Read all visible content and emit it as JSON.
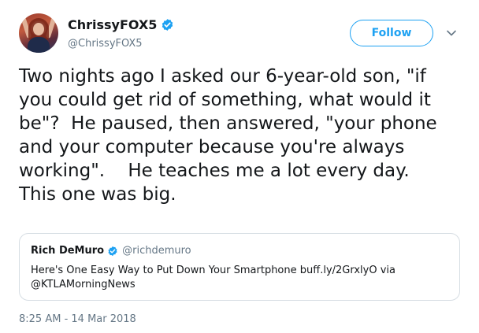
{
  "author": {
    "display_name": "ChrissyFOX5",
    "handle": "@ChrissyFOX5",
    "verified": true
  },
  "follow_button": {
    "label": "Follow"
  },
  "tweet": {
    "text": "Two nights ago I asked our 6-year-old son, \"if\nyou could get rid of something, what would it\nbe\"?  He paused, then answered, \"your phone\nand your computer because you're always\nworking\".    He teaches me a lot every day.\nThis one was big.",
    "timestamp": "8:25 AM - 14 Mar 2018"
  },
  "quoted_tweet": {
    "display_name": "Rich DeMuro",
    "handle": "@richdemuro",
    "verified": true,
    "text": "Here's One Easy Way to Put Down Your Smartphone buff.ly/2GrxlyO via\n@KTLAMorningNews"
  },
  "colors": {
    "accent": "#1da1f2",
    "text": "#14171a",
    "muted": "#657786",
    "border": "#d6dde3"
  },
  "icons": [
    "verified-badge-icon",
    "chevron-down-icon"
  ]
}
